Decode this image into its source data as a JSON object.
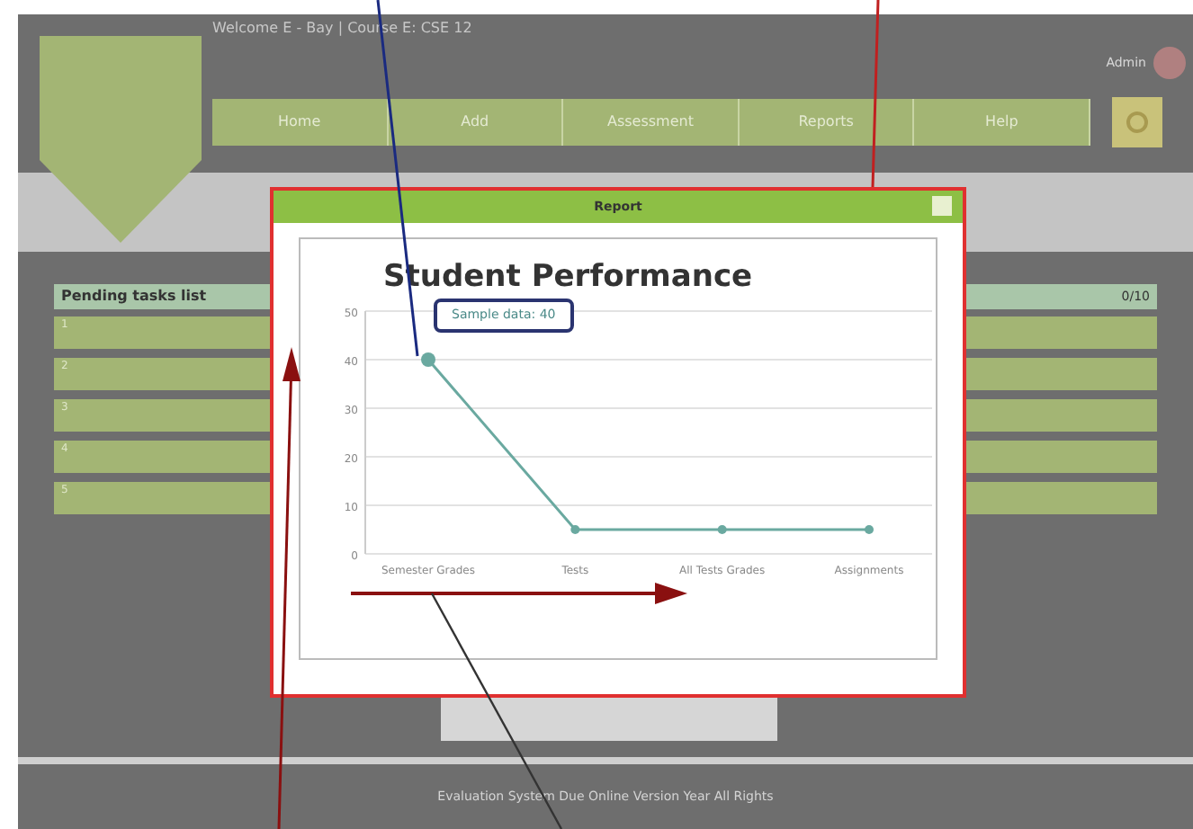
{
  "header": {
    "welcome": "Welcome E - Bay | Course E: CSE 12",
    "user": "Admin"
  },
  "nav": [
    {
      "label": "Home",
      "selected": false
    },
    {
      "label": "Add",
      "selected": false
    },
    {
      "label": "Assessment",
      "selected": false
    },
    {
      "label": "Reports",
      "selected": false
    },
    {
      "label": "Help",
      "selected": false
    }
  ],
  "panel": {
    "title": "Pending tasks list",
    "badge": "0/10",
    "rows": [
      "1",
      "2",
      "3",
      "4",
      "5"
    ]
  },
  "dialog": {
    "title": "Report",
    "chart_data": {
      "type": "line",
      "title": "Student Performance",
      "categories": [
        "Semester Grades",
        "Tests",
        "All Tests Grades",
        "Assignments"
      ],
      "series": [
        {
          "color": "#6aa9a0",
          "marker": true,
          "values": [
            40,
            5,
            5,
            5
          ]
        }
      ],
      "grid": true,
      "ylim": [
        0,
        50
      ],
      "yticks": [
        0,
        10,
        20,
        30,
        40,
        50
      ]
    },
    "tooltip": "Sample data: 40"
  },
  "footer": "Evaluation System Due Online Version Year All Rights"
}
